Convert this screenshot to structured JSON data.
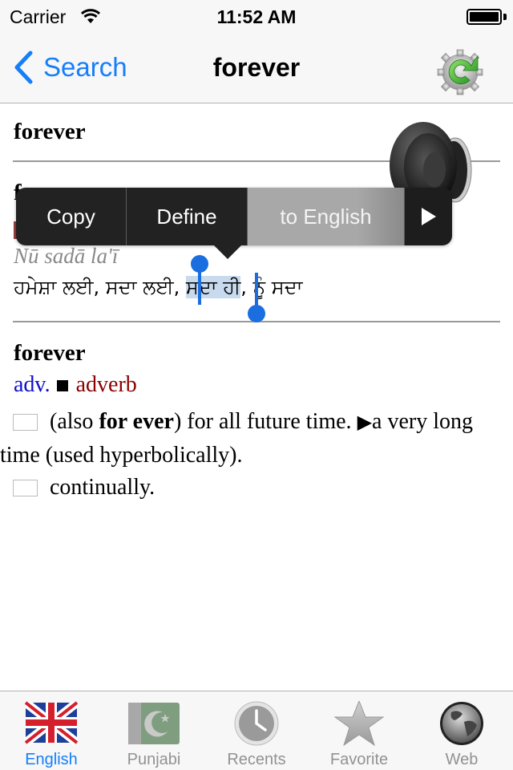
{
  "status_bar": {
    "carrier": "Carrier",
    "time": "11:52 AM"
  },
  "nav": {
    "back_label": "Search",
    "title": "forever"
  },
  "entries": [
    {
      "headword": "forever"
    },
    {
      "headword": "f",
      "transliteration": "Nū sadā la'ī",
      "punjabi_before": "ਹਮੇਸ਼ਾ ਲਈ, ਸਦਾ ਲਈ, ",
      "punjabi_selected": "ਸਦਾ ਹੀ",
      "punjabi_after": ", ਨੂੰ ਸਦਾ"
    },
    {
      "headword": "forever",
      "pos_abbr": "adv.",
      "pos_full": "adverb",
      "senses": [
        {
          "prefix": "(also ",
          "bold": "for ever",
          "text": ") for all future time. ",
          "sub_marker": "▶",
          "sub_text": "a very long time (used hyperbolically)."
        },
        {
          "text": "continually."
        }
      ]
    }
  ],
  "edit_menu": {
    "items": [
      "Copy",
      "Define",
      "to English"
    ],
    "highlighted": "to English",
    "more": "next-arrow"
  },
  "tab_bar": {
    "active": "English",
    "tabs": [
      {
        "label": "English",
        "icon": "uk-flag-icon"
      },
      {
        "label": "Punjabi",
        "icon": "pakistan-flag-icon"
      },
      {
        "label": "Recents",
        "icon": "clock-icon"
      },
      {
        "label": "Favorite",
        "icon": "star-icon"
      },
      {
        "label": "Web",
        "icon": "globe-icon"
      }
    ]
  },
  "colors": {
    "accent": "#157efb",
    "pos_abbr": "#1010c8",
    "pos_full": "#8b0000",
    "selection": "#c8daee",
    "handle": "#1a6ee0"
  }
}
